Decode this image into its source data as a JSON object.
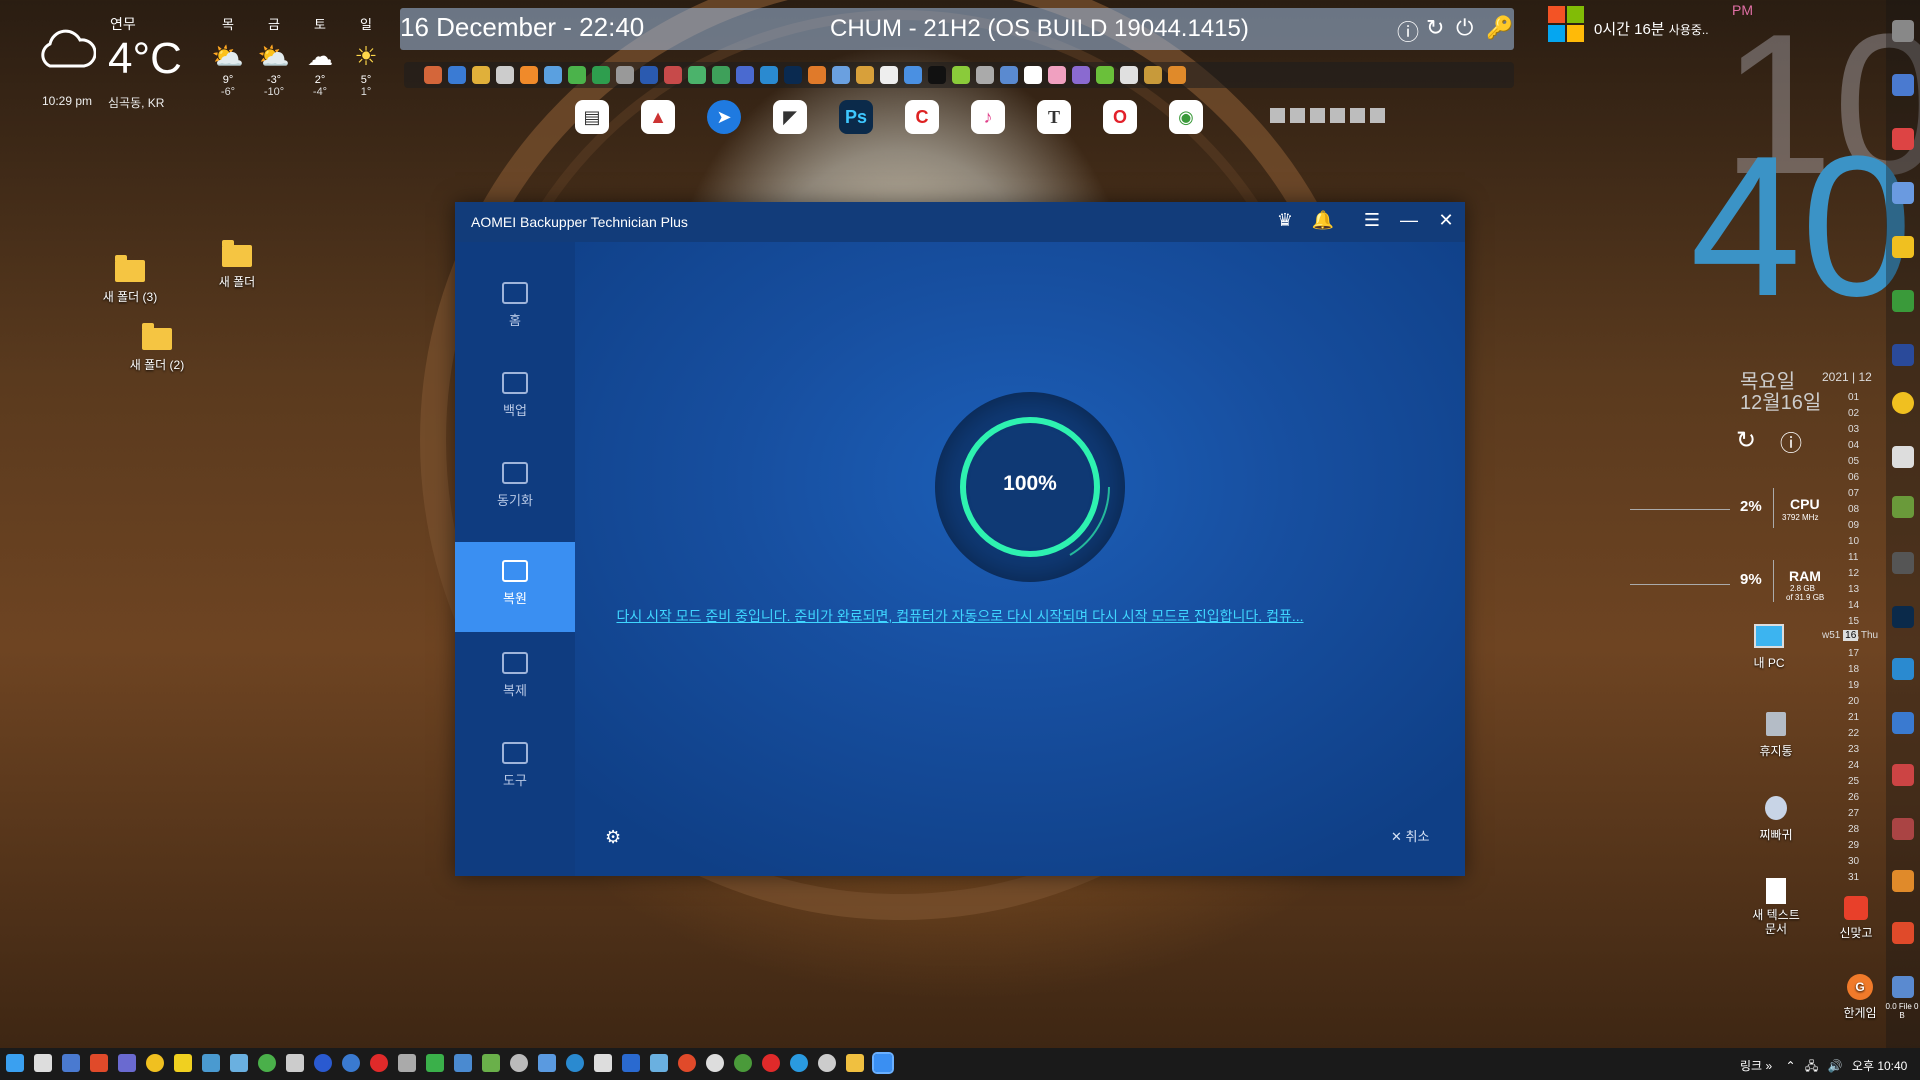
{
  "weather": {
    "city": "연무",
    "temp": "4°C",
    "time": "10:29 pm",
    "location": "심곡동, KR",
    "forecast": [
      {
        "day": "목",
        "icon": "partly-cloudy-icon",
        "hi": "9°",
        "lo": "-6°"
      },
      {
        "day": "금",
        "icon": "partly-cloudy-icon",
        "hi": "-3°",
        "lo": "-10°"
      },
      {
        "day": "토",
        "icon": "snow-cloud-icon",
        "hi": "2°",
        "lo": "-4°"
      },
      {
        "day": "일",
        "icon": "sun-icon",
        "hi": "5°",
        "lo": "1°"
      }
    ]
  },
  "topbar": {
    "datetime": "16 December -  22:40",
    "os": "CHUM - 21H2 (OS BUILD 19044.1415)"
  },
  "desktop": {
    "folder1": "새 폴더 (3)",
    "folder2": "새 폴더",
    "folder3": "새 폴더 (2)",
    "mypc": "내 PC",
    "recycle": "휴지통",
    "jjippa": "찌빠귀",
    "newtext": "새 텍스트 문서",
    "sinmatgo": "신맞고",
    "hangame": "한게임",
    "files": "0.0 File 0 B"
  },
  "app": {
    "title": "AOMEI Backupper Technician Plus",
    "nav": {
      "home": "홈",
      "backup": "백업",
      "sync": "동기화",
      "restore": "복원",
      "clone": "복제",
      "tools": "도구"
    },
    "progress_label": "100%",
    "progress_value": 100,
    "status": "다시 시작 모드 준비 중입니다. 준비가 완료되면, 컴퓨터가 자동으로 다시 시작되며 다시 시작 모드로 진입합니다. 컴퓨...",
    "cancel": "취소"
  },
  "clock": {
    "ampm": "PM",
    "hour": "10",
    "minute": "40",
    "uptime": "0시간 16분",
    "uptime_suffix": "사용중..",
    "dayname": "목요일",
    "date": "12월16일",
    "cal_year": "2021",
    "cal_month": "12",
    "days": [
      "01",
      "02",
      "03",
      "04",
      "05",
      "06",
      "07",
      "08",
      "09",
      "10",
      "11",
      "12",
      "13",
      "14",
      "15",
      "16",
      "17",
      "18",
      "19",
      "20",
      "21",
      "22",
      "23",
      "24",
      "25",
      "26",
      "27",
      "28",
      "29",
      "30",
      "31"
    ],
    "week_label": "w51",
    "week_day": "16",
    "week_abbr": "Thu"
  },
  "system": {
    "cpu_percent": "2%",
    "cpu_label": "CPU",
    "cpu_sub": "3792 MHz",
    "ram_percent": "9%",
    "ram_label": "RAM",
    "ram_sub1": "2.8 GB",
    "ram_sub2": "of 31.9 GB"
  },
  "taskbar": {
    "links": "링크",
    "chevron": "»",
    "ime": "오후 10:40"
  },
  "colors": {
    "accent": "#3a8ff2",
    "progress": "#2ef2b0",
    "link": "#3fd6ff"
  }
}
